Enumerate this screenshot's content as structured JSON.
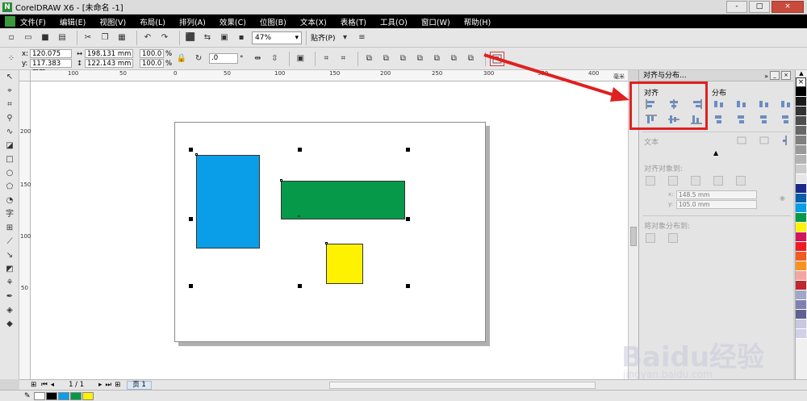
{
  "window": {
    "title": "CorelDRAW X6 - [未命名 -1]",
    "app_icon_label": "N",
    "controls": [
      "-",
      "□",
      "×"
    ]
  },
  "menu": [
    "文件(F)",
    "编辑(E)",
    "视图(V)",
    "布局(L)",
    "排列(A)",
    "效果(C)",
    "位图(B)",
    "文本(X)",
    "表格(T)",
    "工具(O)",
    "窗口(W)",
    "帮助(H)"
  ],
  "standard_toolbar": {
    "icons": [
      "new-icon",
      "open-icon",
      "save-icon",
      "print-icon",
      "cut-icon",
      "copy-icon",
      "paste-icon",
      "undo-icon",
      "redo-icon",
      "import-icon",
      "export-icon",
      "publish-icon",
      "launcher-icon"
    ],
    "zoom": "47%",
    "snap_label": "贴齐(P)"
  },
  "property_bar": {
    "x_label": "x:",
    "x": "120.075 mm",
    "y_label": "y:",
    "y": "117.383 mm",
    "width": "198.131 mm",
    "height": "122.143 mm",
    "scale_x": "100.0",
    "scale_y": "100.0",
    "percent": "%",
    "rotation": ".0",
    "degree": "°"
  },
  "rulers": {
    "horizontal_labels": [
      "100",
      "50",
      "0",
      "50",
      "100",
      "150",
      "200",
      "250",
      "300",
      "350",
      "400"
    ],
    "vertical_labels": [
      "200",
      "150",
      "100",
      "50"
    ],
    "unit": "毫米"
  },
  "objects": [
    {
      "name": "blue-rectangle",
      "color": "#0a9ee8"
    },
    {
      "name": "green-rectangle",
      "color": "#07994a"
    },
    {
      "name": "yellow-rectangle",
      "color": "#fff200"
    }
  ],
  "panel": {
    "title": "对齐与分布...",
    "align_label": "对齐",
    "distribute_label": "分布",
    "text_label": "文本",
    "align_to_label": "对齐对象到:",
    "pos_x": "148.5 mm",
    "pos_y": "105.0 mm",
    "distribute_to_label": "将对象分布到:"
  },
  "palette": [
    "#ffffff",
    "#000000",
    "#1a1a1a",
    "#333333",
    "#4d4d4d",
    "#666666",
    "#808080",
    "#999999",
    "#b3b3b3",
    "#cccccc",
    "#e6e6e6",
    "#1b2a8a",
    "#0a5ea8",
    "#0a9ee8",
    "#07994a",
    "#fff200",
    "#d4145a",
    "#ed1c24",
    "#f15a24",
    "#f7931e",
    "#f4a6a0",
    "#c1272d",
    "#a0a8c8",
    "#8080b0",
    "#606090",
    "#c8c8e0",
    "#d0d0e8"
  ],
  "pagebar": {
    "counter": "1 / 1",
    "tab": "页 1"
  },
  "status": {
    "doc_swatches": [
      "#ffffff",
      "#000000",
      "#0a9ee8",
      "#07994a",
      "#fff200"
    ]
  },
  "watermark": {
    "brand": "Baidu经验",
    "url": "jingyan.baidu.com"
  },
  "highlight_color": "#e02020"
}
